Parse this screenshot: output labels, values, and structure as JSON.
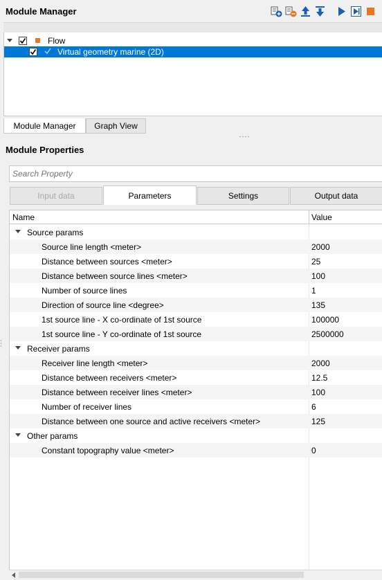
{
  "module_manager": {
    "title": "Module Manager",
    "toolbar": [
      "add-module-icon",
      "remove-module-icon",
      "move-up-icon",
      "move-down-icon",
      "play-icon",
      "step-play-icon",
      "stop-icon"
    ],
    "tree": [
      {
        "label": "Flow",
        "checked": true,
        "expanded": true,
        "icon": "flow-square-icon"
      },
      {
        "label": "Virtual geometry marine (2D)",
        "checked": true,
        "selected": true,
        "icon": "module-check-icon"
      }
    ],
    "tabs": [
      {
        "label": "Module Manager",
        "active": true
      },
      {
        "label": "Graph View",
        "active": false
      }
    ]
  },
  "module_properties": {
    "title": "Module Properties",
    "search_placeholder": "Search Property",
    "tabs": [
      {
        "label": "Input data",
        "enabled": false
      },
      {
        "label": "Parameters",
        "active": true
      },
      {
        "label": "Settings"
      },
      {
        "label": "Output data"
      }
    ],
    "columns": [
      "Name",
      "Value"
    ],
    "groups": [
      {
        "label": "Source params",
        "rows": [
          {
            "name": "Source line length <meter>",
            "value": "2000"
          },
          {
            "name": "Distance between sources <meter>",
            "value": "25"
          },
          {
            "name": "Distance between source lines <meter>",
            "value": "100"
          },
          {
            "name": "Number of source lines",
            "value": "1"
          },
          {
            "name": "Direction of source line <degree>",
            "value": "135"
          },
          {
            "name": "1st source line - X co-ordinate of 1st source",
            "value": "100000"
          },
          {
            "name": "1st source line - Y co-ordinate of 1st source",
            "value": "2500000"
          }
        ]
      },
      {
        "label": "Receiver params",
        "rows": [
          {
            "name": "Receiver line length <meter>",
            "value": "2000"
          },
          {
            "name": "Distance between receivers <meter>",
            "value": "12.5"
          },
          {
            "name": "Distance between receiver lines <meter>",
            "value": "100"
          },
          {
            "name": "Number of receiver lines",
            "value": "6"
          },
          {
            "name": "Distance between one source and active receivers <meter>",
            "value": "125"
          }
        ]
      },
      {
        "label": "Other params",
        "rows": [
          {
            "name": "Constant topography value <meter>",
            "value": "0"
          }
        ]
      }
    ]
  },
  "colors": {
    "selection": "#0078d7",
    "accent_orange": "#e87722",
    "play_blue": "#1a5fb4"
  }
}
